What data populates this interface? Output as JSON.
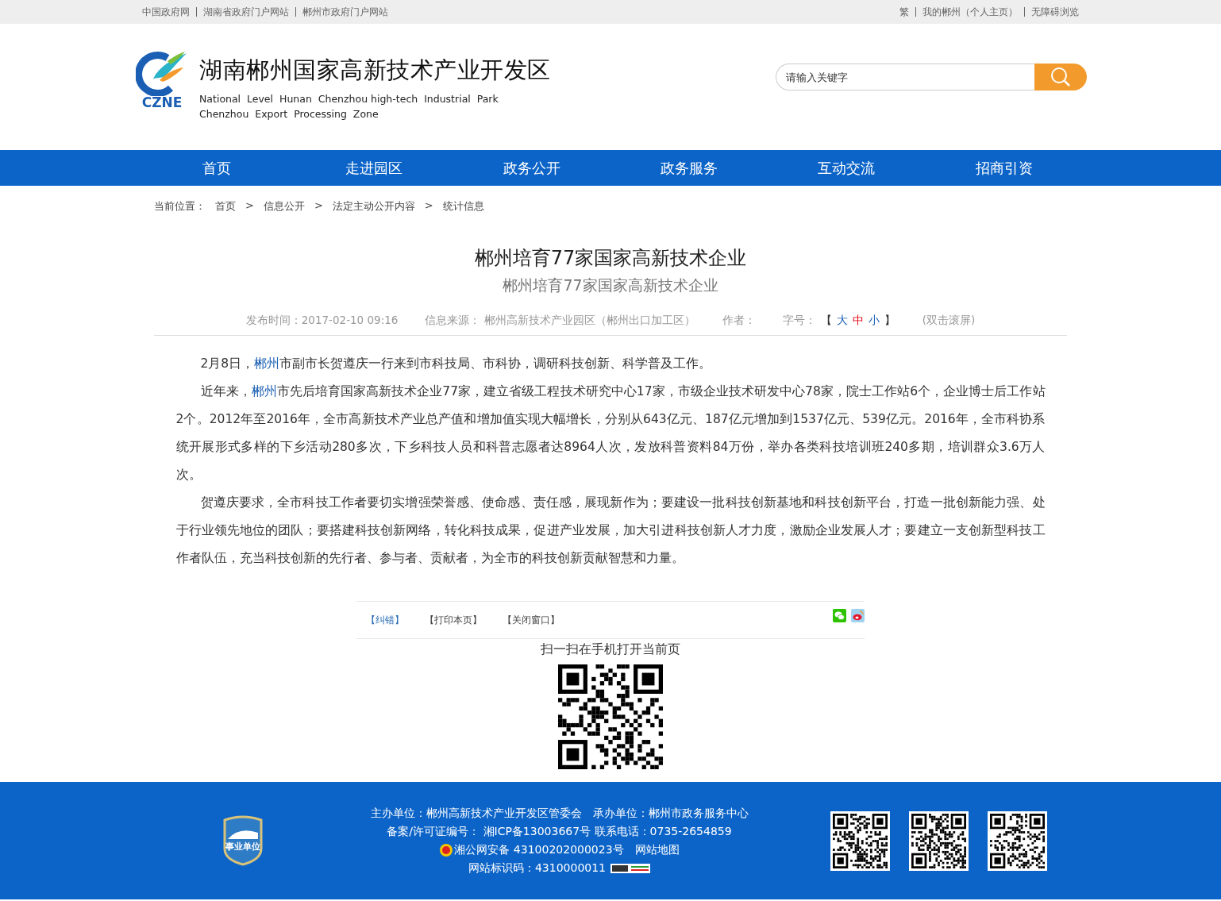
{
  "top_bar": {
    "left_links": [
      "中国政府网",
      "湖南省政府门户网站",
      "郴州市政府门户网站"
    ],
    "right_links": [
      "繁",
      "我的郴州（个人主页）",
      "无障碍浏览"
    ]
  },
  "header": {
    "logo_text": "CZNE",
    "title": "湖南郴州国家高新技术产业开发区",
    "subtitle_lines": [
      "National  Level  Hunan  Chenzhou high-tech  Industrial  Park",
      "Chenzhou  Export  Processing  Zone"
    ],
    "search": {
      "placeholder": "请输入关键字"
    }
  },
  "nav": {
    "items": [
      "首页",
      "走进园区",
      "政务公开",
      "政务服务",
      "互动交流",
      "招商引资"
    ]
  },
  "breadcrumb": {
    "label": "当前位置：",
    "items": [
      "首页",
      "信息公开",
      "法定主动公开内容",
      "统计信息"
    ],
    "separator": ">"
  },
  "article": {
    "title": "郴州培育77家国家高新技术企业",
    "subtitle": "郴州培育77家国家高新技术企业",
    "meta": {
      "published": "发布时间：2017-02-10 09:16",
      "source": "信息来源： 郴州高新技术产业园区（郴州出口加工区）",
      "author": "作者：",
      "font_size_label": "字号：",
      "bracket_open": "【",
      "bracket_close": "】",
      "font_sizes": [
        {
          "label": "大",
          "color": "#1a5fb4"
        },
        {
          "label": "中",
          "color": "#e60012"
        },
        {
          "label": "小",
          "color": "#1a5fb4"
        }
      ],
      "scroll_hint": "(双击滚屏)"
    },
    "paragraphs": [
      [
        {
          "text": "2月8日，",
          "link": false
        },
        {
          "text": "郴州",
          "link": true
        },
        {
          "text": "市副市长贺遵庆一行来到市科技局、市科协，调研科技创新、科学普及工作。",
          "link": false
        }
      ],
      [
        {
          "text": "近年来，",
          "link": false
        },
        {
          "text": "郴州",
          "link": true
        },
        {
          "text": "市先后培育国家高新技术企业77家，建立省级工程技术研究中心17家，市级企业技术研发中心78家，院士工作站6个，企业博士后工作站2个。2012年至2016年，全市高新技术产业总产值和增加值实现大幅增长，分别从643亿元、187亿元增加到1537亿元、539亿元。2016年，全市科协系统开展形式多样的下乡活动280多次，下乡科技人员和科普志愿者达8964人次，发放科普资料84万份，举办各类科技培训班240多期，培训群众3.6万人次。",
          "link": false
        }
      ],
      [
        {
          "text": "贺遵庆要求，全市科技工作者要切实增强荣誉感、使命感、责任感，展现新作为；要建设一批科技创新基地和科技创新平台，打造一批创新能力强、处于行业领先地位的团队；要搭建科技创新网络，转化科技成果，促进产业发展，加大引进科技创新人才力度，激励企业发展人才；要建立一支创新型科技工作者队伍，充当科技创新的先行者、参与者、贡献者，为全市的科技创新贡献智慧和力量。",
          "link": false
        }
      ]
    ],
    "actions": [
      {
        "label": "【纠错】",
        "color": "#2a6db4"
      },
      {
        "label": "【打印本页】",
        "color": "#444444"
      },
      {
        "label": "【关闭窗口】",
        "color": "#444444"
      }
    ],
    "qr_caption": "扫一扫在手机打开当前页"
  },
  "footer": {
    "badge_text": "事业单位",
    "lines": [
      [
        {
          "text": "主办单位：郴州高新技术产业开发区管委会",
          "kind": "text"
        },
        {
          "text": "承办单位：郴州市政务服务中心",
          "kind": "text"
        }
      ],
      [
        {
          "text": "备案/许可证编号： 湘ICP备13003667号 联系电话：0735-2654859",
          "kind": "text"
        }
      ],
      [
        {
          "kind": "police"
        },
        {
          "text": "湘公网安备 43100202000023号",
          "kind": "text"
        },
        {
          "text": "网站地图",
          "kind": "link"
        }
      ],
      [
        {
          "text": "网站标识码：4310000011",
          "kind": "text"
        },
        {
          "kind": "cnzz"
        }
      ]
    ]
  }
}
